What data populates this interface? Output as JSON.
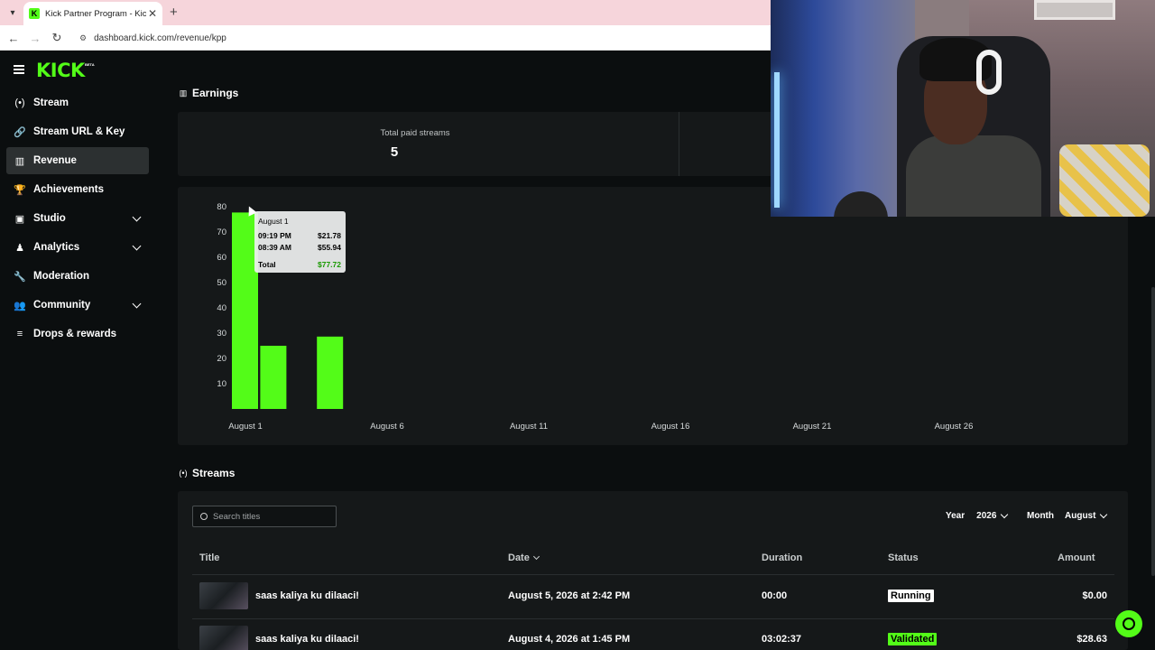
{
  "browser": {
    "tab_title": "Kick Partner Program - Kick Da",
    "url": "dashboard.kick.com/revenue/kpp",
    "favicon_letter": "K"
  },
  "sidebar": {
    "logo": "KICK",
    "logo_badge": "BETA",
    "items": [
      {
        "label": "Stream",
        "icon": "broadcast-icon"
      },
      {
        "label": "Stream URL & Key",
        "icon": "link-icon"
      },
      {
        "label": "Revenue",
        "icon": "chart-icon",
        "active": true
      },
      {
        "label": "Achievements",
        "icon": "trophy-icon"
      },
      {
        "label": "Studio",
        "icon": "studio-icon",
        "expandable": true
      },
      {
        "label": "Analytics",
        "icon": "analytics-icon",
        "expandable": true
      },
      {
        "label": "Moderation",
        "icon": "wrench-icon"
      },
      {
        "label": "Community",
        "icon": "people-icon",
        "expandable": true
      },
      {
        "label": "Drops & rewards",
        "icon": "gift-icon"
      }
    ]
  },
  "earnings": {
    "title": "Earnings",
    "stat_label": "Total paid streams",
    "stat_value": "5"
  },
  "chart_data": {
    "type": "bar",
    "y_ticks": [
      10,
      20,
      30,
      40,
      50,
      60,
      70,
      80
    ],
    "ylim": [
      0,
      80
    ],
    "x_tick_labels": [
      "August 1",
      "August 6",
      "August 11",
      "August 16",
      "August 21",
      "August 26"
    ],
    "bars": [
      {
        "day": 1,
        "value": 77.72
      },
      {
        "day": 2,
        "value": 25
      },
      {
        "day": 4,
        "value": 28.63
      }
    ],
    "colors": {
      "bar": "#53fc18"
    },
    "tooltip": {
      "title": "August 1",
      "rows": [
        {
          "label": "09:19 PM",
          "value": "$21.78"
        },
        {
          "label": "08:39 AM",
          "value": "$55.94"
        }
      ],
      "total_label": "Total",
      "total_value": "$77.72"
    }
  },
  "streams": {
    "title": "Streams",
    "search_placeholder": "Search titles",
    "year_label": "Year",
    "year_value": "2026",
    "month_label": "Month",
    "month_value": "August",
    "columns": {
      "title": "Title",
      "date": "Date",
      "duration": "Duration",
      "status": "Status",
      "amount": "Amount"
    },
    "rows": [
      {
        "title": "saas kaliya ku dilaaci!",
        "date": "August 5, 2026 at 2:42 PM",
        "duration": "00:00",
        "status": "Running",
        "amount": "$0.00"
      },
      {
        "title": "saas kaliya ku dilaaci!",
        "date": "August 4, 2026 at 1:45 PM",
        "duration": "03:02:37",
        "status": "Validated",
        "amount": "$28.63"
      }
    ]
  },
  "colors": {
    "accent": "#53fc18",
    "background": "#0b0e0f",
    "card": "#151819"
  }
}
